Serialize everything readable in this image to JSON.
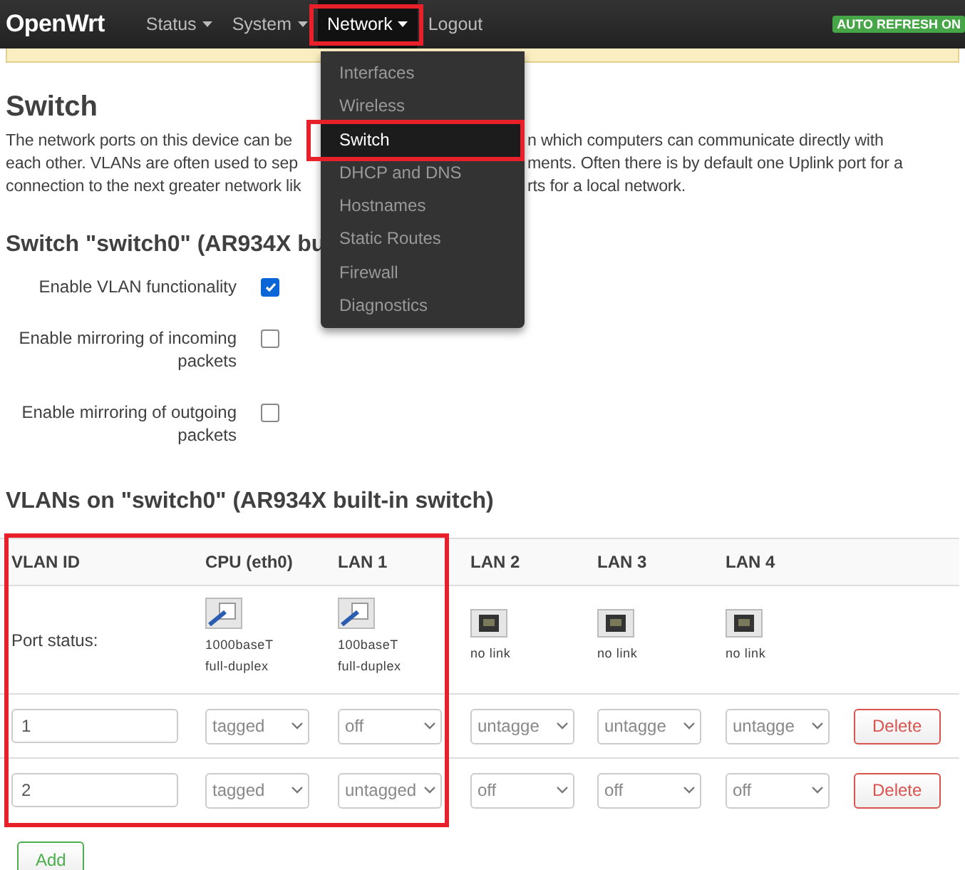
{
  "navbar": {
    "brand": "OpenWrt",
    "items": [
      {
        "label": "Status",
        "dropdown": true,
        "open": false,
        "highlighted": false
      },
      {
        "label": "System",
        "dropdown": true,
        "open": false,
        "highlighted": false
      },
      {
        "label": "Network",
        "dropdown": true,
        "open": true,
        "highlighted": true
      },
      {
        "label": "Logout",
        "dropdown": false,
        "open": false,
        "highlighted": false
      }
    ],
    "badge": "AUTO REFRESH ON"
  },
  "menu": {
    "items": [
      {
        "label": "Interfaces",
        "selected": false,
        "highlighted": false
      },
      {
        "label": "Wireless",
        "selected": false,
        "highlighted": false
      },
      {
        "label": "Switch",
        "selected": true,
        "highlighted": true
      },
      {
        "label": "DHCP and DNS",
        "selected": false,
        "highlighted": false
      },
      {
        "label": "Hostnames",
        "selected": false,
        "highlighted": false
      },
      {
        "label": "Static Routes",
        "selected": false,
        "highlighted": false
      },
      {
        "label": "Firewall",
        "selected": false,
        "highlighted": false
      },
      {
        "label": "Diagnostics",
        "selected": false,
        "highlighted": false
      }
    ]
  },
  "page_title": "Switch",
  "description_lines": [
    {
      "left": "The network ports on this device can be",
      "right": "n which computers can communicate directly with"
    },
    {
      "left": "each other. VLANs are often used to sep",
      "right": "ments. Often there is by default one Uplink port for a"
    },
    {
      "left": "connection to the next greater network lik",
      "right": "rts for a local network."
    }
  ],
  "switch_section": {
    "title": "Switch \"switch0\" (AR934X bu",
    "options": [
      {
        "label": "Enable VLAN functionality",
        "checked": true
      },
      {
        "label": "Enable mirroring of incoming packets",
        "checked": false
      },
      {
        "label": "Enable mirroring of outgoing packets",
        "checked": false
      }
    ]
  },
  "vlan_section": {
    "title": "VLANs on \"switch0\" (AR934X built-in switch)",
    "columns": [
      {
        "label": "VLAN ID",
        "highlighted": true
      },
      {
        "label": "CPU (eth0)",
        "highlighted": true
      },
      {
        "label": "LAN 1",
        "highlighted": true
      },
      {
        "label": "LAN 2",
        "highlighted": false
      },
      {
        "label": "LAN 3",
        "highlighted": false
      },
      {
        "label": "LAN 4",
        "highlighted": false
      }
    ],
    "port_status_label": "Port status:",
    "ports": [
      {
        "connected": true,
        "lines": [
          "1000baseT",
          "full-duplex"
        ]
      },
      {
        "connected": true,
        "lines": [
          "100baseT",
          "full-duplex"
        ]
      },
      {
        "connected": false,
        "lines": [
          "no link"
        ]
      },
      {
        "connected": false,
        "lines": [
          "no link"
        ]
      },
      {
        "connected": false,
        "lines": [
          "no link"
        ]
      }
    ],
    "rows": [
      {
        "vlan_id": "1",
        "ports": [
          "tagged",
          "off",
          "untagge",
          "untagge",
          "untagge"
        ],
        "action": "Delete"
      },
      {
        "vlan_id": "2",
        "ports": [
          "tagged",
          "untagged",
          "off",
          "off",
          "off"
        ],
        "action": "Delete"
      }
    ],
    "add_button": "Add"
  }
}
